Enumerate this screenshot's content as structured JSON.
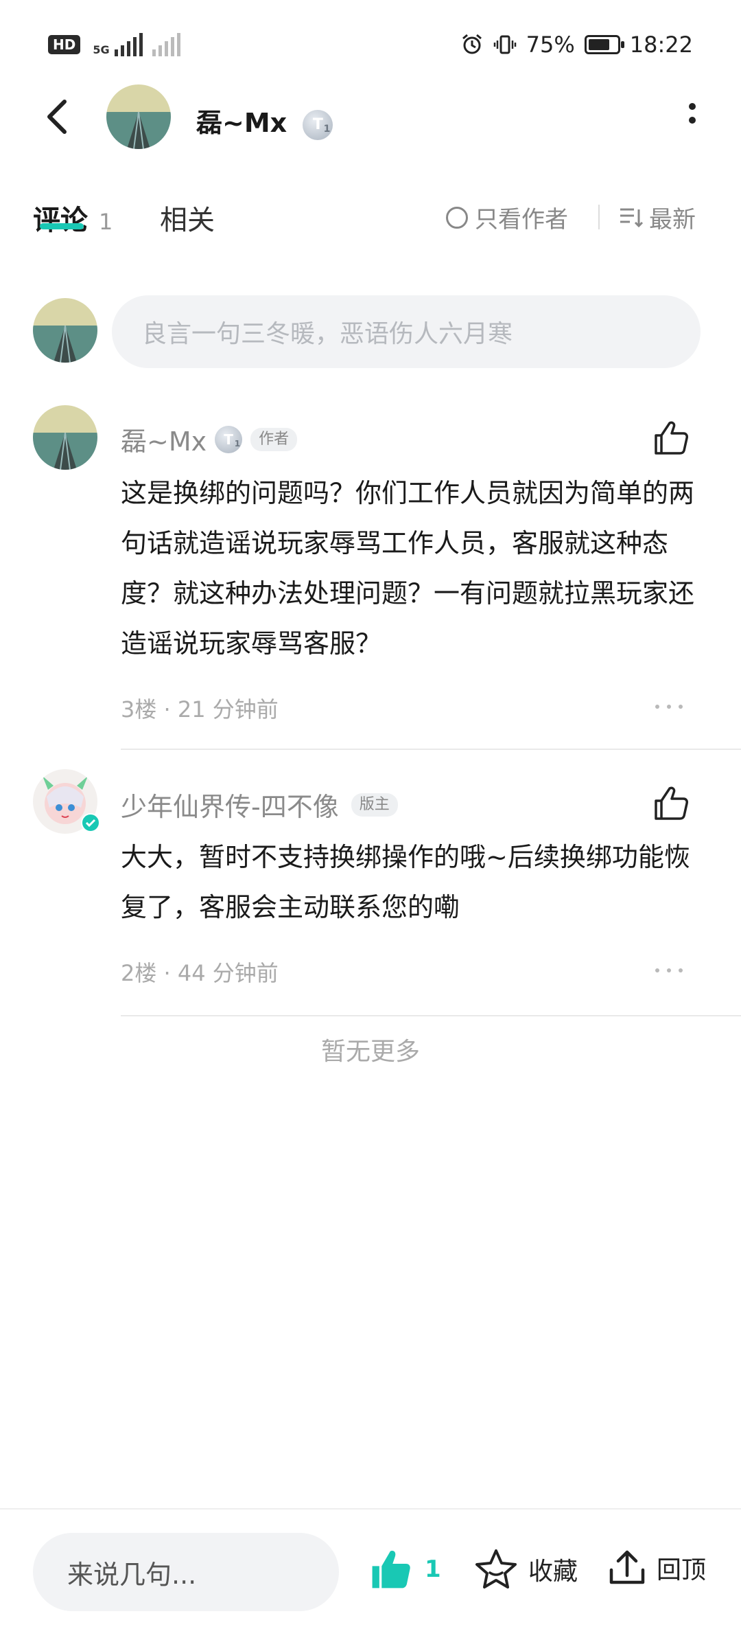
{
  "status_bar": {
    "hd": "HD",
    "sim1": "1",
    "network": "5G",
    "battery": "75%",
    "battery_level": 0.75,
    "time": "18:22"
  },
  "header": {
    "title": "磊~Mx",
    "level": "T",
    "level_num": "1"
  },
  "tabs": {
    "comments_label": "评论",
    "comments_count": "1",
    "related_label": "相关",
    "author_only": "只看作者",
    "sort": "最新"
  },
  "compose": {
    "placeholder": "良言一句三冬暖，恶语伤人六月寒"
  },
  "comments": [
    {
      "name": "磊~Mx",
      "level": "T",
      "level_num": "1",
      "tag": "作者",
      "body": "这是换绑的问题吗？你们工作人员就因为简单的两句话就造谣说玩家辱骂工作人员，客服就这种态度？就这种办法处理问题？一有问题就拉黑玩家还造谣说玩家辱骂客服？",
      "meta": "3楼 · 21 分钟前"
    },
    {
      "name": "少年仙界传-四不像",
      "tag": "版主",
      "body": "大大，暂时不支持换绑操作的哦~后续换绑功能恢复了，客服会主动联系您的嘞",
      "meta": "2楼 · 44 分钟前"
    }
  ],
  "no_more": "暂无更多",
  "bottom_bar": {
    "input_placeholder": "来说几句...",
    "like_count": "1",
    "favorite": "收藏",
    "back_top": "回顶"
  },
  "colors": {
    "accent": "#19c8b4",
    "muted": "#8a8a8a"
  }
}
